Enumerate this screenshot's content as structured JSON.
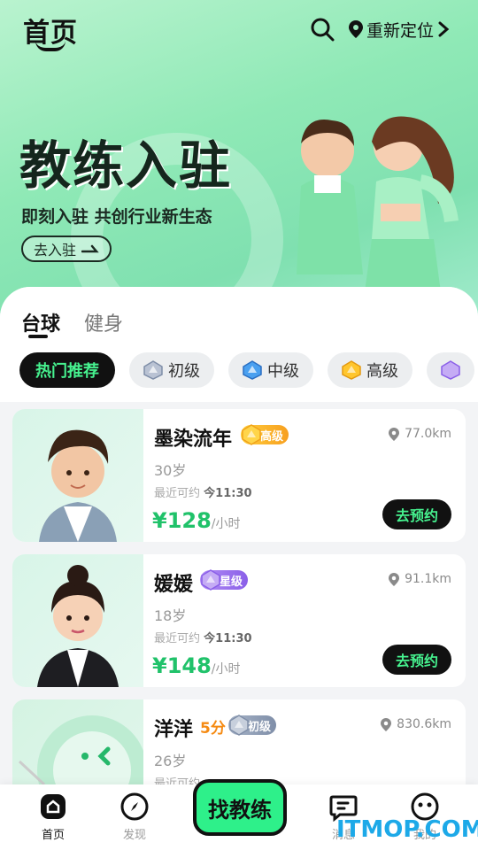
{
  "header": {
    "logo_text": "首页",
    "location_label": "重新定位"
  },
  "banner": {
    "title": "教练入驻",
    "subtitle": "即刻入驻 共创行业新生态",
    "cta": "去入驻"
  },
  "category_tabs": [
    {
      "label": "台球",
      "active": true
    },
    {
      "label": "健身",
      "active": false
    }
  ],
  "level_filters": [
    {
      "label": "热门推荐",
      "active": true
    },
    {
      "label": "初级",
      "icon": "silver-gem-icon"
    },
    {
      "label": "中级",
      "icon": "blue-gem-icon"
    },
    {
      "label": "高级",
      "icon": "gold-gem-icon"
    }
  ],
  "coaches": [
    {
      "name": "墨染流年",
      "level": "高级",
      "distance": "77.0km",
      "age": "30岁",
      "recent_label": "最近可约",
      "recent_time": "今11:30",
      "price": "¥128",
      "unit": "/小时",
      "book": "去预约"
    },
    {
      "name": "媛媛",
      "level": "星级",
      "distance": "91.1km",
      "age": "18岁",
      "recent_label": "最近可约",
      "recent_time": "今11:30",
      "price": "¥148",
      "unit": "/小时",
      "book": "去预约"
    },
    {
      "name": "洋洋",
      "score": "5分",
      "level": "初级",
      "distance": "830.6km",
      "age": "26岁",
      "recent_label": "最近可约"
    }
  ],
  "bottom_nav": {
    "home": "首页",
    "discover": "发现",
    "center": "找教练",
    "messages": "消息",
    "mine": "我的"
  },
  "watermark": "ITMOP.COM",
  "colors": {
    "accent_green": "#2ef08a",
    "price_green": "#20c26a",
    "dark": "#111111"
  }
}
